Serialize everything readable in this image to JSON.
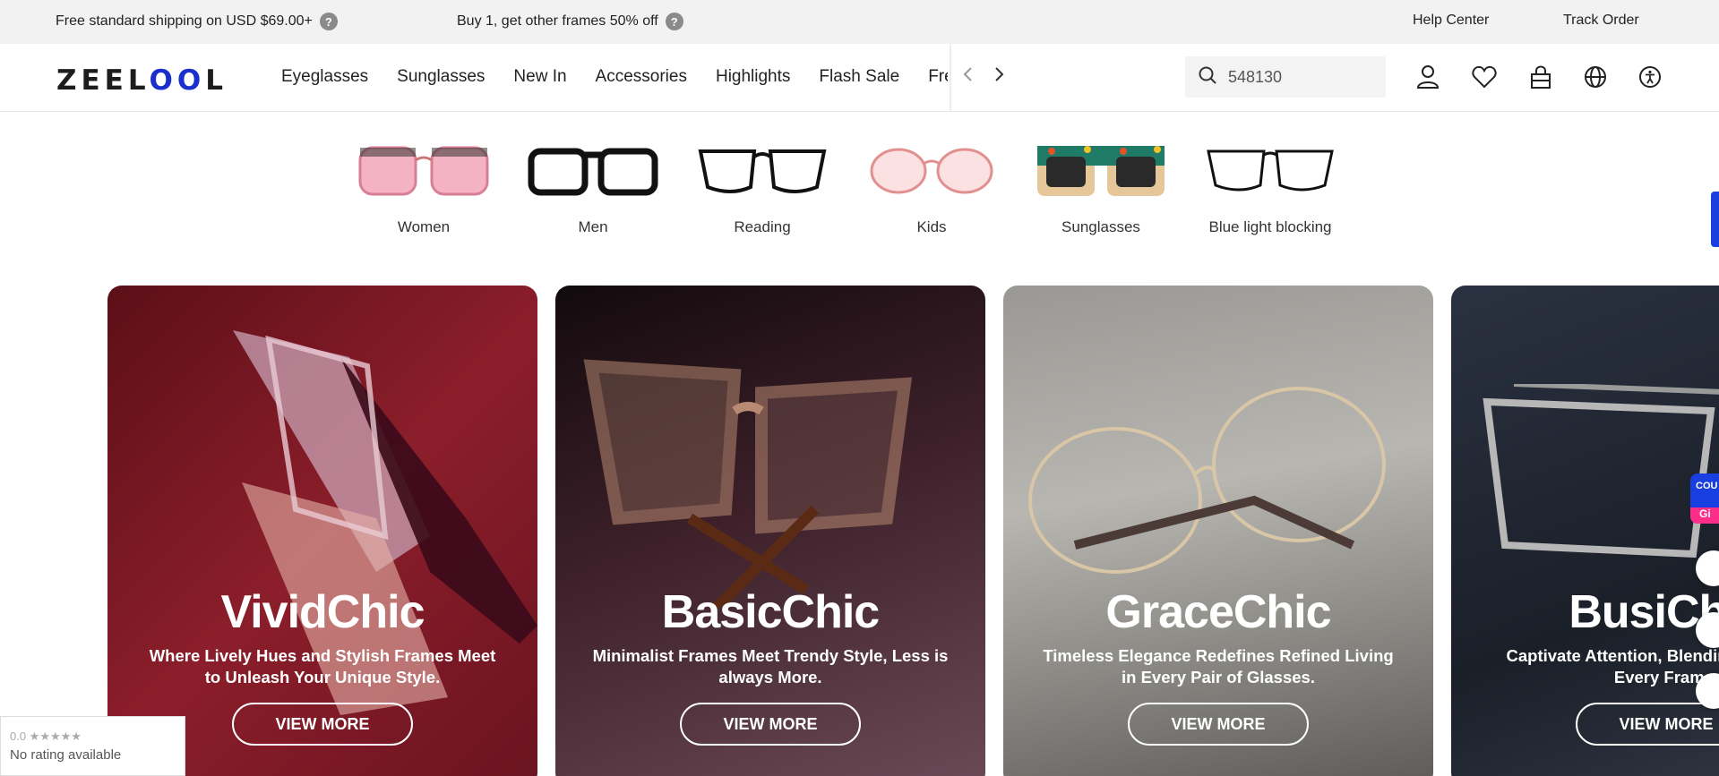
{
  "topbar": {
    "promo1": "Free standard shipping on USD $69.00+",
    "promo2": "Buy 1, get other frames 50% off",
    "help": "Help Center",
    "track": "Track Order"
  },
  "header": {
    "logo": "ZEELOOL",
    "nav": [
      "Eyeglasses",
      "Sunglasses",
      "New In",
      "Accessories",
      "Highlights",
      "Flash Sale",
      "Free"
    ],
    "search_value": "548130"
  },
  "categories": [
    "Women",
    "Men",
    "Reading",
    "Kids",
    "Sunglasses",
    "Blue light blocking"
  ],
  "cards": [
    {
      "title": "VividChic",
      "desc": "Where Lively Hues and Stylish Frames Meet to Unleash Your Unique Style.",
      "button": "VIEW MORE"
    },
    {
      "title": "BasicChic",
      "desc": "Minimalist Frames Meet Trendy Style, Less is always More.",
      "button": "VIEW MORE"
    },
    {
      "title": "GraceChic",
      "desc": "Timeless Elegance Redefines Refined Living in Every Pair of Glasses.",
      "button": "VIEW MORE"
    },
    {
      "title": "BusiChic",
      "desc": "Captivate Attention, Blending Comfort in Every Frame.",
      "button": "VIEW MORE"
    }
  ],
  "rating": {
    "stars": "0.0 ★★★★★",
    "text": "No rating available"
  },
  "coupon": {
    "line1": "COU",
    "line2": "Gi"
  },
  "colors": {
    "brand_blue": "#1a2fcc",
    "card1": "#6e1521",
    "card2": "#3a1d24",
    "card3": "#8c8a86",
    "card4": "#1e2530"
  }
}
